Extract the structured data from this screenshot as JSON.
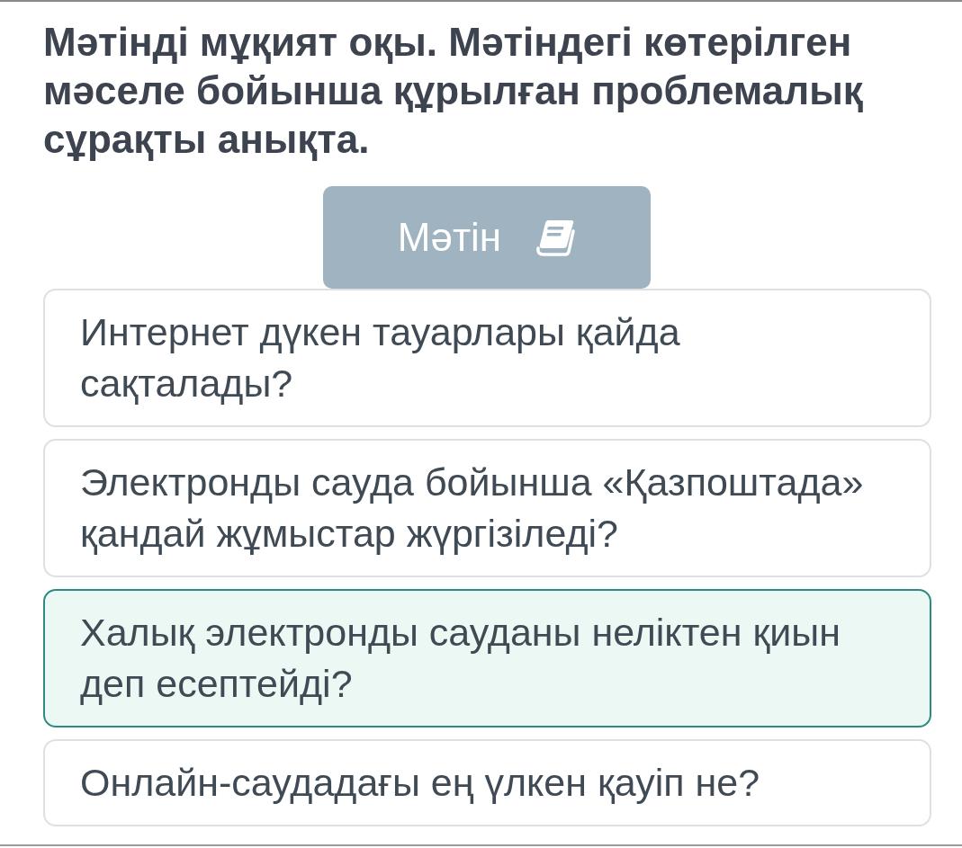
{
  "question": {
    "text": "Мәтінді мұқият оқы. Мәтіндегі көтерілген мәселе бойынша құрылған проблемалық сұрақты анықта."
  },
  "text_button": {
    "label": "Мәтін"
  },
  "options": [
    {
      "text": "Интернет дүкен тауарлары қайда сақталады?",
      "selected": false
    },
    {
      "text": "Электронды сауда бойынша «Қазпоштада» қандай жұмыстар жүргізіледі?",
      "selected": false
    },
    {
      "text": "Халық электронды сауданы неліктен қиын деп есептейді?",
      "selected": true
    },
    {
      "text": "Онлайн-саудадағы ең үлкен қауіп не?",
      "selected": false
    }
  ]
}
